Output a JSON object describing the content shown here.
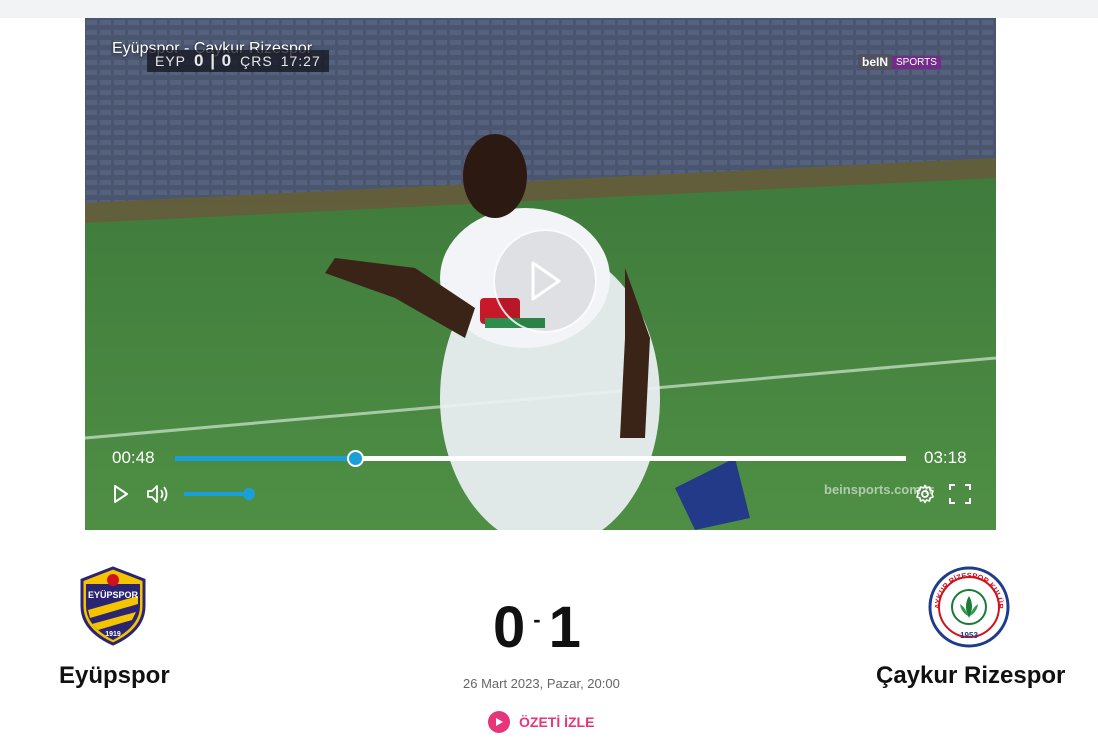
{
  "video": {
    "title": "Eyüpspor - Çaykur Rizespor",
    "scorebug": {
      "home": "EYP",
      "score": "0 | 0",
      "away": "ÇRS",
      "clock": "17:27"
    },
    "broadcaster": {
      "brand": "beIN",
      "channel": "SPORTS"
    },
    "watermark": "beinsports.com.tr",
    "current_time": "00:48",
    "duration": "03:18",
    "progress_percent": 24.6,
    "volume_percent": 95
  },
  "match": {
    "home": {
      "name": "Eyüpspor",
      "logo_text": "EYÜPSPOR",
      "logo_year": "1919"
    },
    "away": {
      "name": "Çaykur Rizespor",
      "logo_text": "ÇAYKUR RİZESPOR KULÜBÜ",
      "logo_year": "1953"
    },
    "home_score": "0",
    "separator": "-",
    "away_score": "1",
    "datetime": "26 Mart 2023, Pazar, 20:00",
    "summary_button": "ÖZETİ İZLE"
  },
  "colors": {
    "accent": "#1a9fd8",
    "summary": "#e6357a"
  }
}
